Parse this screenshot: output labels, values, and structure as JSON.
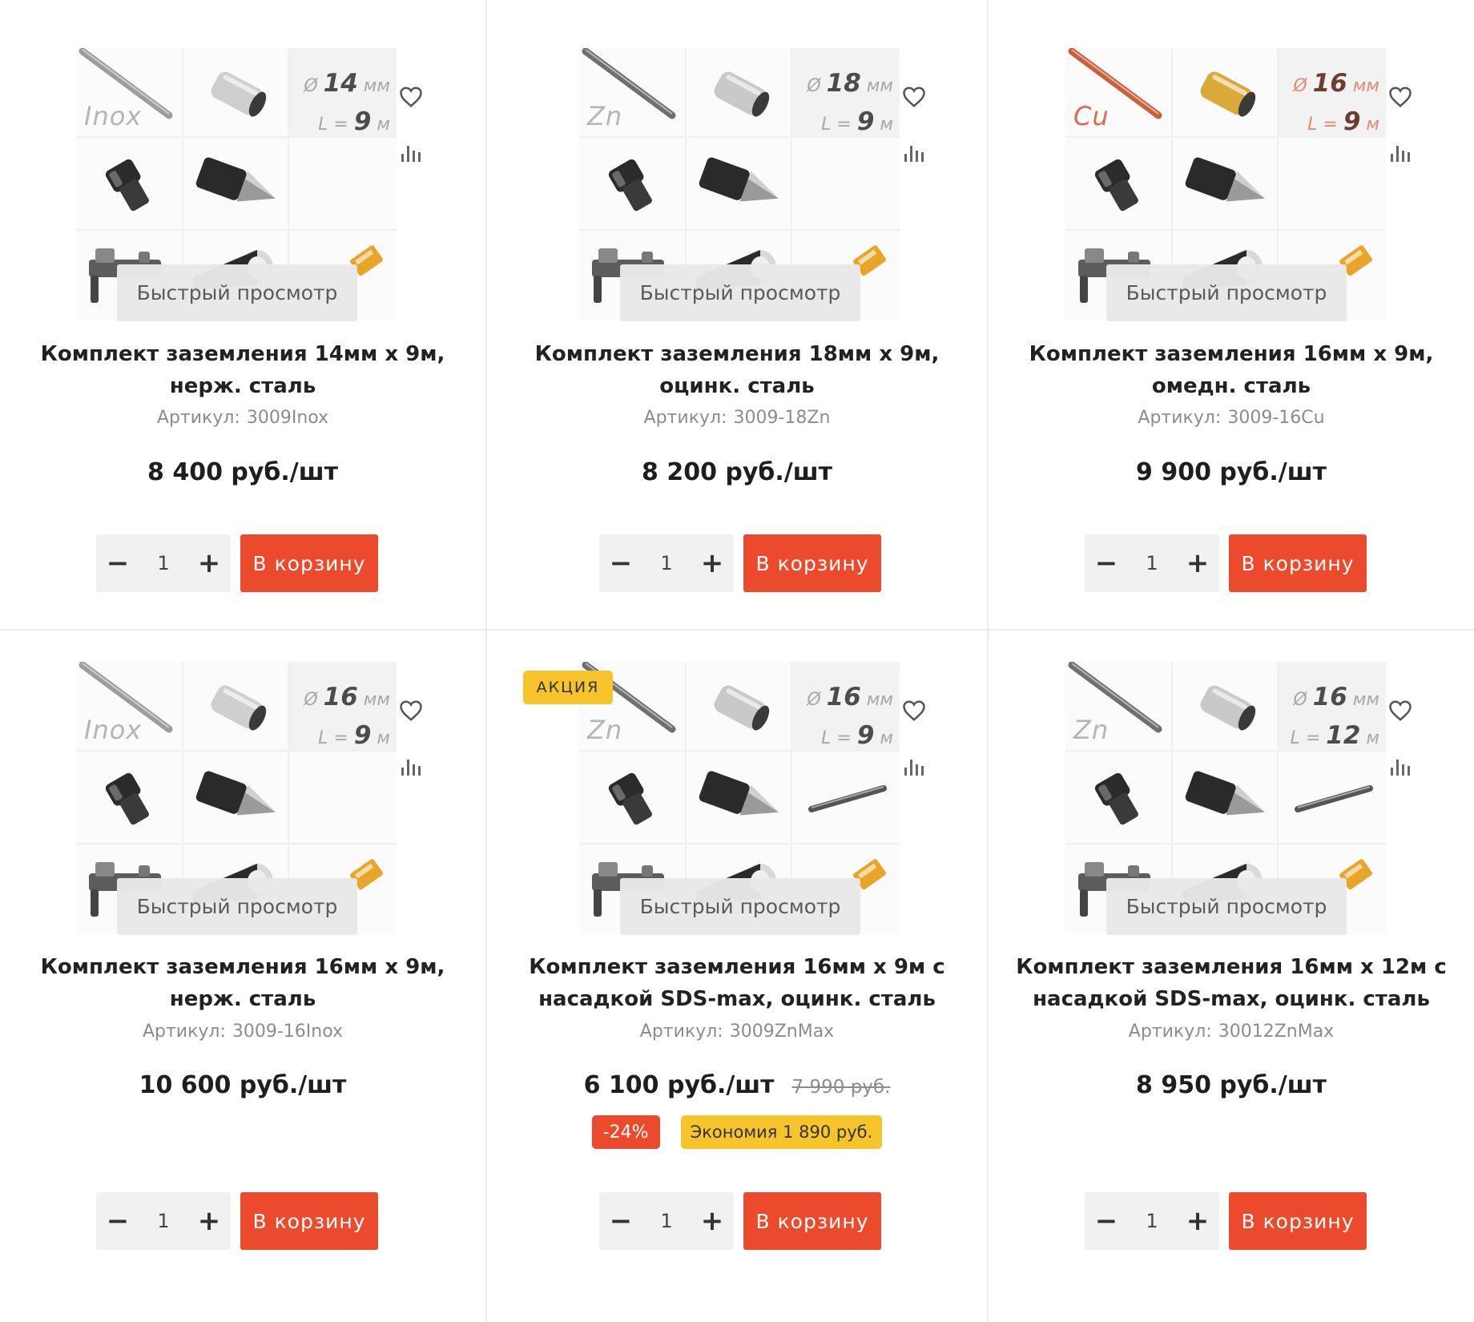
{
  "products": [
    {
      "metal": "Inox",
      "metal_type": "inox",
      "diameter": "14",
      "length": "9",
      "unit_mm": "мм",
      "unit_m": "м",
      "quick_view": "Быстрый просмотр",
      "title_line1": "Комплект заземления 14мм х 9м,",
      "title_line2": "нерж. сталь",
      "sku_label": "Артикул:",
      "sku": "3009Inox",
      "price": "8 400 руб./шт",
      "qty": "1",
      "cart_label": "В корзину",
      "extra_rod": false
    },
    {
      "metal": "Zn",
      "metal_type": "zn",
      "diameter": "18",
      "length": "9",
      "unit_mm": "мм",
      "unit_m": "м",
      "quick_view": "Быстрый просмотр",
      "title_line1": "Комплект заземления 18мм х 9м,",
      "title_line2": "оцинк. сталь",
      "sku_label": "Артикул:",
      "sku": "3009-18Zn",
      "price": "8 200 руб./шт",
      "qty": "1",
      "cart_label": "В корзину",
      "extra_rod": false
    },
    {
      "metal": "Cu",
      "metal_type": "cu",
      "diameter": "16",
      "length": "9",
      "unit_mm": "мм",
      "unit_m": "м",
      "quick_view": "Быстрый просмотр",
      "title_line1": "Комплект заземления 16мм х 9м,",
      "title_line2": "омедн. сталь",
      "sku_label": "Артикул:",
      "sku": "3009-16Cu",
      "price": "9 900 руб./шт",
      "qty": "1",
      "cart_label": "В корзину",
      "extra_rod": false
    },
    {
      "metal": "Inox",
      "metal_type": "inox",
      "diameter": "16",
      "length": "9",
      "unit_mm": "мм",
      "unit_m": "м",
      "quick_view": "Быстрый просмотр",
      "title_line1": "Комплект заземления 16мм х 9м,",
      "title_line2": "нерж. сталь",
      "sku_label": "Артикул:",
      "sku": "3009-16Inox",
      "price": "10 600 руб./шт",
      "qty": "1",
      "cart_label": "В корзину",
      "extra_rod": false
    },
    {
      "metal": "Zn",
      "metal_type": "zn",
      "diameter": "16",
      "length": "9",
      "unit_mm": "мм",
      "unit_m": "м",
      "badge": "АКЦИЯ",
      "quick_view": "Быстрый просмотр",
      "title_line1": "Комплект заземления 16мм х 9м с",
      "title_line2": "насадкой SDS-max, оцинк. сталь",
      "sku_label": "Артикул:",
      "sku": "3009ZnMax",
      "price": "6 100 руб./шт",
      "old_price": "7 990 руб.",
      "discount": "-24%",
      "savings": "Экономия 1 890 руб.",
      "qty": "1",
      "cart_label": "В корзину",
      "extra_rod": true
    },
    {
      "metal": "Zn",
      "metal_type": "zn",
      "diameter": "16",
      "length": "12",
      "unit_mm": "мм",
      "unit_m": "м",
      "quick_view": "Быстрый просмотр",
      "title_line1": "Комплект заземления 16мм х 12м с",
      "title_line2": "насадкой SDS-max, оцинк. сталь",
      "sku_label": "Артикул:",
      "sku": "30012ZnMax",
      "price": "8 950 руб./шт",
      "qty": "1",
      "cart_label": "В корзину",
      "extra_rod": true
    }
  ],
  "colors": {
    "accent": "#ec4a2c",
    "badge_yellow": "#f7c52b",
    "qty_bg": "#f1f1f1",
    "copper": "#c8623d",
    "brass": "#d9a93a"
  },
  "icons": {
    "favorite": "heart-icon",
    "compare": "compare-bars-icon",
    "minus": "minus-icon",
    "plus": "plus-icon"
  }
}
